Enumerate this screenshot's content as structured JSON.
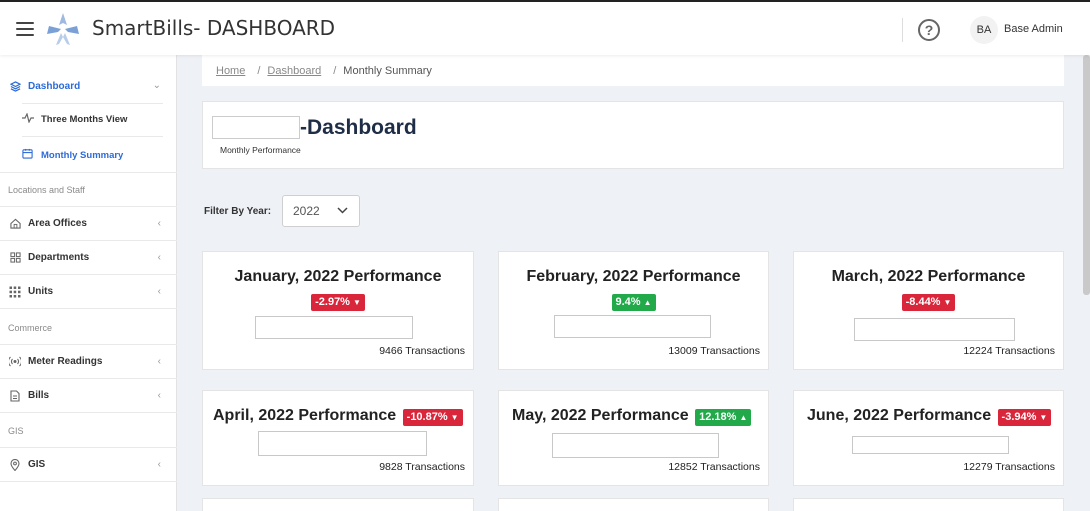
{
  "app": {
    "title": "SmartBills- DASHBOARD",
    "user_initials": "BA",
    "user_name": "Base Admin"
  },
  "sidebar": {
    "dashboard": "Dashboard",
    "three_months": "Three Months View",
    "monthly_summary": "Monthly Summary",
    "section_locations": "Locations and Staff",
    "area_offices": "Area Offices",
    "departments": "Departments",
    "units": "Units",
    "section_commerce": "Commerce",
    "meter_readings": "Meter Readings",
    "bills": "Bills",
    "section_gis": "GIS",
    "gis": "GIS"
  },
  "breadcrumb": {
    "home": "Home",
    "dashboard": "Dashboard",
    "current": "Monthly Summary",
    "sep": "/"
  },
  "header": {
    "title": "-Dashboard",
    "subtitle": "Monthly Performance"
  },
  "filter": {
    "label": "Filter By Year:",
    "year": "2022"
  },
  "cards": [
    {
      "title": "January, 2022 Performance",
      "change": "-2.97%",
      "direction": "down",
      "transactions": "9466 Transactions"
    },
    {
      "title": "February, 2022 Performance",
      "change": "9.4%",
      "direction": "up",
      "transactions": "13009 Transactions"
    },
    {
      "title": "March, 2022 Performance",
      "change": "-8.44%",
      "direction": "down",
      "transactions": "12224 Transactions"
    },
    {
      "title": "April, 2022 Performance",
      "change": "-10.87%",
      "direction": "down",
      "transactions": "9828 Transactions"
    },
    {
      "title": "May, 2022 Performance",
      "change": "12.18%",
      "direction": "up",
      "transactions": "12852 Transactions"
    },
    {
      "title": "June, 2022 Performance",
      "change": "-3.94%",
      "direction": "down",
      "transactions": "12279 Transactions"
    }
  ],
  "colors": {
    "accent": "#2c6bd8",
    "negative": "#d9263a",
    "positive": "#22a94a",
    "title": "#1f2d47"
  }
}
